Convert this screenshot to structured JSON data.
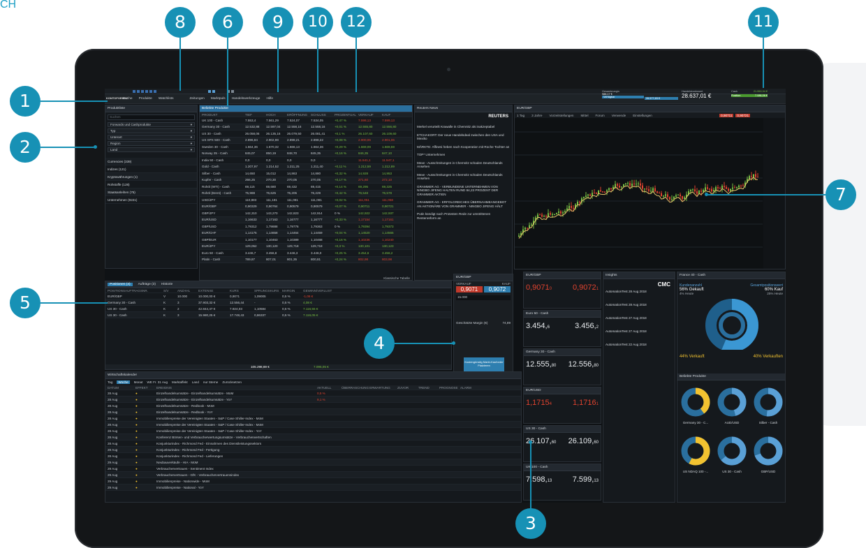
{
  "corner_label": "CH",
  "callouts": [
    "1",
    "2",
    "3",
    "4",
    "5",
    "6",
    "7",
    "8",
    "9",
    "10",
    "11",
    "12"
  ],
  "menu": [
    "Suche",
    "Produkte",
    "Watchlists",
    "Zeitungen",
    "Marktpuls",
    "Handelswerkzeuge",
    "Hilfe"
  ],
  "logo": "KONTOFORMAT",
  "account": {
    "gesamt_label": "Gesamtmargin",
    "gesamt_value": "988,17 €",
    "verfuegbar_label": "Verfügbar",
    "verfuegbar_value": "26.577,83 €",
    "handelskonto_label": "Handelskontowert",
    "handelskonto_value": "28.637,01 €",
    "cash_label": "Cash",
    "cash_value": "21.550,94 €",
    "position_label": "Position",
    "position_value": "7.086,06 €"
  },
  "produktliste": {
    "title": "Produktliste",
    "search_placeholder": "Suchen",
    "filters": [
      "Forwards und Cashprodukte",
      "Typ",
      "Unterart",
      "Region",
      "Land"
    ],
    "categories": [
      "Currencies (339)",
      "Indizes (121)",
      "Kryptowährungen (1)",
      "Rohstoffe (128)",
      "Staatsanleihen (75)",
      "Unternehmen (9221)"
    ]
  },
  "beliebte": {
    "title": "Beliebte Produkte",
    "columns": [
      "PRODUKT",
      "TIEF",
      "HOCH",
      "ERÖFFNUNG",
      "SCHLUSS",
      "PROZENTUAL",
      "VERKAUF",
      "KAUF"
    ],
    "rows": [
      [
        "UK 100 - Cash",
        "7.553,4",
        "7.561,29",
        "7.524,07",
        "7.534,05",
        "+0,47 %",
        "7.598,13",
        "7.599,13"
      ],
      [
        "Germany 30 - Cash",
        "12.532,88",
        "12.597,04",
        "12.558,16",
        "12.558,16",
        "+0,01 %",
        "12.555,80",
        "12.556,80"
      ],
      [
        "US 30 - Cash",
        "26.058,06",
        "26.135,16",
        "26.079,50",
        "26.081,41",
        "+0,1 %",
        "26.107,60",
        "26.109,60"
      ],
      [
        "US SPX 500 - Cash",
        "2.896,84",
        "2.902,98",
        "2.898,21",
        "2.898,22",
        "+0,08 %",
        "2.900,06",
        "2.901,06"
      ],
      [
        "Sweden 30 - Cash",
        "1.664,36",
        "1.670,32",
        "1.666,13",
        "1.664,36",
        "+0,29 %",
        "1.669,09",
        "1.669,59"
      ],
      [
        "Norway 25 - Cash",
        "845,07",
        "850,19",
        "848,70",
        "845,35",
        "+0,16 %",
        "846,35",
        "847,10"
      ],
      [
        "India 50 - Cash",
        "0,0",
        "0,0",
        "0,0",
        "0,0",
        "-",
        "11.541,1",
        "11.547,1"
      ],
      [
        "Gold - Cash",
        "1.207,97",
        "1.214,52",
        "1.211,25",
        "1.211,40",
        "+0,11 %",
        "1.212,59",
        "1.212,89"
      ],
      [
        "Silber - Cash",
        "14,650",
        "15,012",
        "14,863",
        "14,880",
        "+0,32 %",
        "14,928",
        "14,953"
      ],
      [
        "Kupfer - Cash",
        "266,25",
        "270,30",
        "270,05",
        "270,05",
        "+0,17 %",
        "271,60",
        "272,10"
      ],
      [
        "Rohöl (WTI) - Cash",
        "69,115",
        "69,680",
        "69,432",
        "69,415",
        "+0,14 %",
        "69,295",
        "69,325"
      ],
      [
        "Rohöl (Brent) - Cash",
        "75,988",
        "76,625",
        "76,205",
        "76,229",
        "+0,42 %",
        "76,548",
        "76,578"
      ],
      [
        "USD/JPY",
        "110,883",
        "111,181",
        "111,081",
        "111,081",
        "+0,02 %",
        "111,051",
        "111,058"
      ],
      [
        "EUR/GBP",
        "0,90329",
        "0,90764",
        "0,90579",
        "0,90579",
        "+0,07 %",
        "0,90711",
        "0,90721"
      ],
      [
        "GBP/JPY",
        "142,310",
        "143,270",
        "142,823",
        "142,914",
        "0 %",
        "142,922",
        "142,937"
      ],
      [
        "EUR/USD",
        "1,16633",
        "1,17163",
        "1,16777",
        "1,16777",
        "+0,33 %",
        "1,17154",
        "1,17161"
      ],
      [
        "GBP/USD",
        "1,79312",
        "1,79888",
        "1,79776",
        "1,79363",
        "0 %",
        "1,79394",
        "1,79373"
      ],
      [
        "EUR/CHF",
        "1,14175",
        "1,14658",
        "1,14464",
        "1,14459",
        "+0,04 %",
        "1,14520",
        "1,14565"
      ],
      [
        "GBP/EUR",
        "1,10177",
        "1,10463",
        "1,10389",
        "1,10468",
        "+0,16 %",
        "1,10236",
        "1,10240"
      ],
      [
        "EUR/JPY",
        "129,052",
        "130,120",
        "129,718",
        "129,718",
        "+0,3 %",
        "130,101",
        "130,123"
      ],
      [
        "Euro 50 - Cash",
        "3.446,7",
        "3.456,8",
        "3.446,3",
        "3.446,0",
        "+0,25 %",
        "3.454,6",
        "3.456,2"
      ],
      [
        "Platin - Cash",
        "789,87",
        "807,01",
        "801,35",
        "800,81",
        "+0,24 %",
        "802,98",
        "803,98"
      ]
    ],
    "footer": "Klassische Tabelle"
  },
  "news": {
    "title": "Reuters News",
    "brand": "REUTERS",
    "items": [
      "Merkel verurteilt Krawalle in Chemnitz als inakzeptabel",
      "ETCHAKORT: Der neue Handelsdeal zwischen den USA und Mexiko",
      "MÄRKTE: Affinesi heben nach Kooperation mit Roche Tochter an",
      "TOP* Unternehmen",
      "Mexe - Ausschreitungen in Chemnitz schaden Deutschlands Ansehen",
      "Mexe - Ausschreitungen in Chemnitz schaden Deutschlands Ansehen",
      "GRAMMER AG - VERBUNDENE UNTERNEHMEN VON NINGBO JIFENG HALTEN RUND 84,23 PROZENT DER GRAMMER AKTIEN",
      "GRAMMER AG - ERFOLGREICHES ÜBERNAHMEANGEBOT AN AKTIONÄRE VON GRAMMER - NINGBO JIFENG HÄLT",
      "Putin kündigt nach Protesten Rede zur umstrittenen Rentenreform an"
    ]
  },
  "chart": {
    "title": "EUR/GBP",
    "controls": [
      "1 Tag",
      "3 Jahre",
      "Vorzeitstellungen",
      "Mittel",
      "Forum",
      "Verwende",
      "Einstellungen"
    ],
    "price_sell": "0,90711",
    "price_buy": "0,90721"
  },
  "positions": {
    "tabs": [
      "Positionen (4)",
      "Aufträge (3)",
      "Historie"
    ],
    "columns": [
      "POSITIONSAUFTRAGSNR.",
      "S/V",
      "ANZAHL",
      "EXTENSE",
      "KURS",
      "SPRUNGSKURS",
      "MARGIN",
      "GEWINN/VERLUST"
    ],
    "rows": [
      [
        "EUR/GBP",
        "V",
        "10.000",
        "10.000,00 €",
        "0,9071",
        "1,09005",
        "0,5 %",
        "-1,06 €"
      ],
      [
        "Germany 30 - Cash",
        "K",
        "3",
        "37.903,32 €",
        "12.556,44",
        "-",
        "0,5 %",
        "4,08 €"
      ],
      [
        "US 30 - Cash",
        "K",
        "2",
        "42.844,47 €",
        "7.924,03",
        "1,10584",
        "0,5 %",
        "7.116,55 €"
      ],
      [
        "US 30 - Cash",
        "K",
        "3",
        "15.980,25 €",
        "17.748,43",
        "0,86337",
        "0,5 %",
        "7.116,05 €"
      ]
    ],
    "total": "105.298,69 €",
    "total_gv": "7.095,05 €"
  },
  "ticket": {
    "title": "EUR/GBP",
    "sell": "0,9071",
    "buy": "0,9072",
    "verkauf": "VERKAUF",
    "kauf": "KAUF",
    "einheiten": "15.000",
    "margin_label": "Geschätzte Margin (€)",
    "margin_value": "74,89",
    "button": "Kostengünstig Markt-Kauforder Platzieren"
  },
  "kalender": {
    "title": "Wirtschaftskalender",
    "filters": [
      "Tag",
      "Woche",
      "Monat",
      "WE Fr. 31 Aug",
      "Marktaffekt",
      "Land",
      "nur Sterne",
      "Zurücksetzen"
    ],
    "columns": [
      "DATUM",
      "EFFEKT",
      "EREIGNIS",
      "AKTUELL",
      "ÜBERRASCHUNG",
      "ERWARTUNG",
      "ZUVOR",
      "TREND",
      "PROGNOSE",
      "ALARM"
    ],
    "rows": [
      [
        "28 Aug",
        "Einzelhandelsumsätze - Einzelhandelsumsätze - MoM",
        "0,5 %"
      ],
      [
        "28 Aug",
        "Einzelhandelsumsätze - Einzelhandelsumsätze - YoY",
        "9,1 %"
      ],
      [
        "28 Aug",
        "Einzelhandelsumsätze - Redbook - MoM",
        ""
      ],
      [
        "28 Aug",
        "Einzelhandelsumsätze - Redbook - YoY",
        ""
      ],
      [
        "28 Aug",
        "Immobilienpreise der Vereinigten Staaten - S&P / Case Shiller-Index - MoM",
        ""
      ],
      [
        "28 Aug",
        "Immobilienpreise der Vereinigten Staaten - S&P / Case Shiller-Index - MoM",
        ""
      ],
      [
        "28 Aug",
        "Immobilienpreise der Vereinigten Staaten - S&P / Case Shiller-Index - YoY",
        ""
      ],
      [
        "28 Aug",
        "Konferenz Börsen- und Verbraucherwertungsumsätze - Verbraucherwertschaften",
        ""
      ],
      [
        "28 Aug",
        "Konjunkturindex - Richmond Fed - Einnahmen des Dienstleistungssektors",
        ""
      ],
      [
        "28 Aug",
        "Konjunkturindex - Richmond Fed - Fertigung",
        ""
      ],
      [
        "28 Aug",
        "Konjunkturindex - Richmond Fed - Lieferungen",
        ""
      ],
      [
        "29 Aug",
        "Neubauverkäufe - HIA - MoM",
        ""
      ],
      [
        "29 Aug",
        "Verbrauchervertrauen - Sentiment Index",
        ""
      ],
      [
        "29 Aug",
        "Verbrauchervertrauen - GfK - Verbrauchervertrauensindex",
        ""
      ],
      [
        "29 Aug",
        "Immobilienpreise - Nationwide - MoM",
        ""
      ],
      [
        "29 Aug",
        "Immobilienpreise - National - YoY",
        ""
      ]
    ]
  },
  "quotes": [
    {
      "name": "EUR/GBP",
      "sell": "0,9071",
      "sell_sub": "0",
      "buy": "0,9072",
      "buy_sub": "1",
      "sell_red": true
    },
    {
      "name": "Euro 50 - Cash",
      "sell": "3.454,",
      "sell_sub": "6",
      "buy": "3.456,",
      "buy_sub": "2",
      "sell_red": false
    },
    {
      "name": "Germany 30 - Cash",
      "sell": "12.555,",
      "sell_sub": "80",
      "buy": "12.556,",
      "buy_sub": "80",
      "sell_red": false
    },
    {
      "name": "EUR/USD",
      "sell": "1,1715",
      "sell_sub": "4",
      "buy": "1,1716",
      "buy_sub": "1",
      "sell_red": true
    },
    {
      "name": "US 30 - Cash",
      "sell": "26.107,",
      "sell_sub": "60",
      "buy": "26.109,",
      "buy_sub": "60",
      "sell_red": false
    },
    {
      "name": "UK 100 - Cash",
      "sell": "7.598,",
      "sell_sub": "13",
      "buy": "7.599,",
      "buy_sub": "13",
      "sell_red": false
    }
  ],
  "insights": {
    "title": "Insights",
    "brand": "CMC",
    "items": [
      "AutomationTest 28 Aug 2018",
      "AutomationTest 28 Aug 2018",
      "AutomationTest 27 Aug 2018",
      "AutomationTest 27 Aug 2018",
      "AutomationTest 22 Aug 2018"
    ]
  },
  "sentiment": {
    "title": "France 40 - Cash",
    "left_label": "Kundenanzahl",
    "left_pct": "56% Gekauft",
    "left_sub": "4% Heute",
    "right_label": "Gesamtpositionswert",
    "right_pct": "60% Kauf",
    "right_sub": "25% Heute",
    "verkauft_left": "44% Verkauft",
    "verkauft_right": "40% Verkauften",
    "popular_title": "Beliebte Produkte",
    "popular": [
      "Germany 30 - C...",
      "AUD/USD",
      "Silber - Cash",
      "US NDAQ 100 -...",
      "US 30 - Cash",
      "GBP/USD"
    ]
  },
  "colors": {
    "accent": "#1791b5",
    "panel_bg": "#15191d",
    "up": "#78c043",
    "down": "#e2432f",
    "header_blue": "#2a6f9e"
  }
}
